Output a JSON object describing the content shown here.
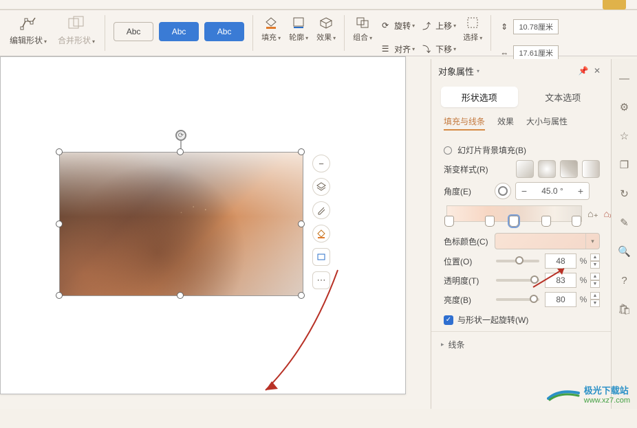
{
  "ribbon": {
    "edit_shape": "编辑形状",
    "merge_shape": "合并形状",
    "abc": "Abc",
    "fill": "填充",
    "outline": "轮廓",
    "effect": "效果",
    "group": "组合",
    "rotate": "旋转",
    "align": "对齐",
    "up": "上移",
    "down": "下移",
    "select": "选择",
    "size_h": "10.78厘米",
    "size_w": "17.61厘米"
  },
  "panel": {
    "title": "对象属性",
    "tab_shape": "形状选项",
    "tab_text": "文本选项",
    "sub_fill": "填充与线条",
    "sub_effect": "效果",
    "sub_size": "大小与属性",
    "bg_fill": "幻灯片背景填充(B)",
    "grad_style": "渐变样式(R)",
    "angle": "角度(E)",
    "angle_val": "45.0 °",
    "stop_color": "色标颜色(C)",
    "position": "位置(O)",
    "position_val": "48",
    "transparency": "透明度(T)",
    "transparency_val": "83",
    "brightness": "亮度(B)",
    "brightness_val": "80",
    "percent": "%",
    "rotate_with": "与形状一起旋转(W)",
    "line": "线条"
  },
  "chart_data": {
    "type": "table",
    "title": "Gradient fill properties",
    "rows": [
      {
        "property": "角度(E)",
        "value": 45.0,
        "unit": "°"
      },
      {
        "property": "位置(O)",
        "value": 48,
        "unit": "%"
      },
      {
        "property": "透明度(T)",
        "value": 83,
        "unit": "%"
      },
      {
        "property": "亮度(B)",
        "value": 80,
        "unit": "%"
      }
    ]
  },
  "watermark": {
    "name": "极光下载站",
    "url": "www.xz7.com"
  }
}
